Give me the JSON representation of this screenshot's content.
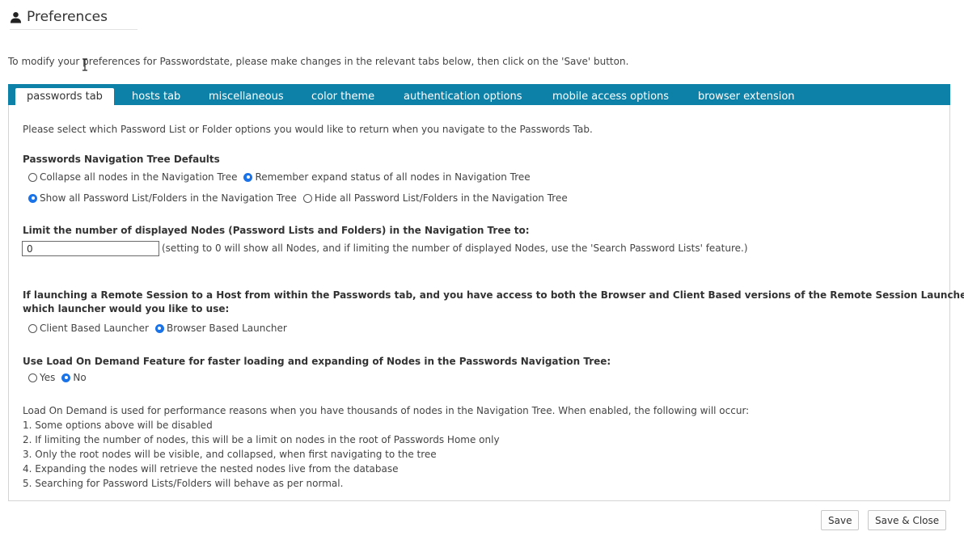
{
  "header": {
    "title": "Preferences",
    "icon": "user-icon"
  },
  "intro_text": "To modify your preferences for Passwordstate, please make changes in the relevant tabs below, then click on the 'Save' button.",
  "tabs": [
    {
      "label": "passwords tab",
      "active": true
    },
    {
      "label": "hosts tab",
      "active": false
    },
    {
      "label": "miscellaneous",
      "active": false
    },
    {
      "label": "color theme",
      "active": false
    },
    {
      "label": "authentication options",
      "active": false
    },
    {
      "label": "mobile access options",
      "active": false
    },
    {
      "label": "browser extension",
      "active": false
    }
  ],
  "passwords_tab": {
    "description": "Please select which Password List or Folder options you would like to return when you navigate to the Passwords Tab.",
    "nav_tree_heading": "Passwords Navigation Tree Defaults",
    "expand_options": [
      {
        "label": "Collapse all nodes in the Navigation Tree",
        "selected": false
      },
      {
        "label": "Remember expand status of all nodes in Navigation Tree",
        "selected": true
      }
    ],
    "show_options": [
      {
        "label": "Show all Password List/Folders in the Navigation Tree",
        "selected": true
      },
      {
        "label": "Hide all Password List/Folders in the Navigation Tree",
        "selected": false
      }
    ],
    "limit_heading": "Limit the number of displayed Nodes (Password Lists and Folders) in the Navigation Tree to:",
    "limit_value": "0",
    "limit_hint": "(setting to 0 will show all Nodes, and if limiting the number of displayed Nodes, use the 'Search Password Lists' feature.)",
    "remote_heading_1": "If launching a Remote Session to a Host from within the Passwords tab, and you have access to both the Browser and Client Based versions of the Remote Session Launcher,",
    "remote_heading_2": "which launcher would you like to use:",
    "launcher_options": [
      {
        "label": "Client Based Launcher",
        "selected": false
      },
      {
        "label": "Browser Based Launcher",
        "selected": true
      }
    ],
    "lod_heading": "Use Load On Demand Feature for faster loading and expanding of Nodes in the Passwords Navigation Tree:",
    "lod_options": [
      {
        "label": "Yes",
        "selected": false
      },
      {
        "label": "No",
        "selected": true
      }
    ],
    "lod_notes": [
      "Load On Demand is used for performance reasons when you have thousands of nodes in the Navigation Tree. When enabled, the following will occur:",
      "1. Some options above will be disabled",
      "2. If limiting the number of nodes, this will be a limit on nodes in the root of Passwords Home only",
      "3. Only the root nodes will be visible, and collapsed, when first navigating to the tree",
      "4. Expanding the nodes will retrieve the nested nodes live from the database",
      "5. Searching for Password Lists/Folders will behave as per normal."
    ]
  },
  "buttons": {
    "save": "Save",
    "save_close": "Save & Close"
  },
  "colors": {
    "tab_bar": "#0d81a8",
    "radio_selected": "#1a73e8"
  }
}
